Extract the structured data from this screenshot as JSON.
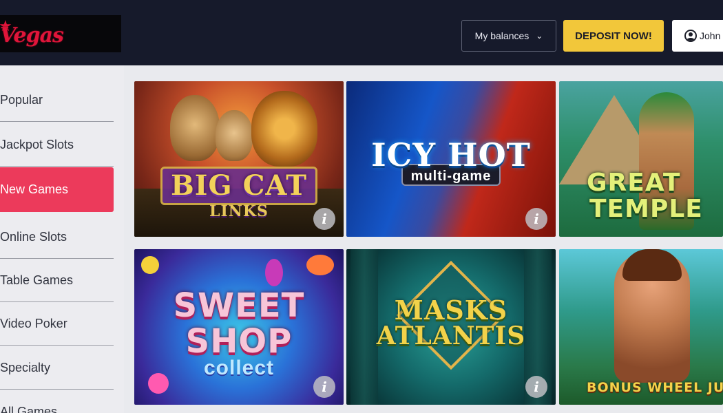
{
  "header": {
    "logo_text": "Vegas",
    "balances_label": "My balances",
    "deposit_label": "DEPOSIT NOW!",
    "user_name": "John"
  },
  "sidebar": {
    "items": [
      {
        "label": "Popular",
        "active": false
      },
      {
        "label": "Jackpot Slots",
        "active": false
      },
      {
        "label": "New Games",
        "active": true
      },
      {
        "label": "Online Slots",
        "active": false
      },
      {
        "label": "Table Games",
        "active": false
      },
      {
        "label": "Video Poker",
        "active": false
      },
      {
        "label": "Specialty",
        "active": false
      },
      {
        "label": "All Games",
        "active": false
      }
    ]
  },
  "games": [
    {
      "title_line1": "BIG CAT",
      "title_line2": "LINKS"
    },
    {
      "title_line1": "ICY HOT",
      "title_line2": "multi-game"
    },
    {
      "title_line1": "GREAT",
      "title_line2": "TEMPLE"
    },
    {
      "title_line1": "SWEET",
      "title_line2": "SHOP",
      "title_line3": "collect"
    },
    {
      "title_line1": "MASKS",
      "title_line2": "ATLANTIS"
    },
    {
      "title_line1": "BONUS WHEEL JUNGLE"
    }
  ],
  "info_label": "i",
  "colors": {
    "header_bg": "#161a2b",
    "accent_pink": "#ec3a5b",
    "deposit_yellow": "#f2c73a",
    "logo_red": "#e0153a"
  },
  "icons": {
    "chevron": "chevron-down-icon",
    "user": "user-icon",
    "info": "info-icon"
  }
}
